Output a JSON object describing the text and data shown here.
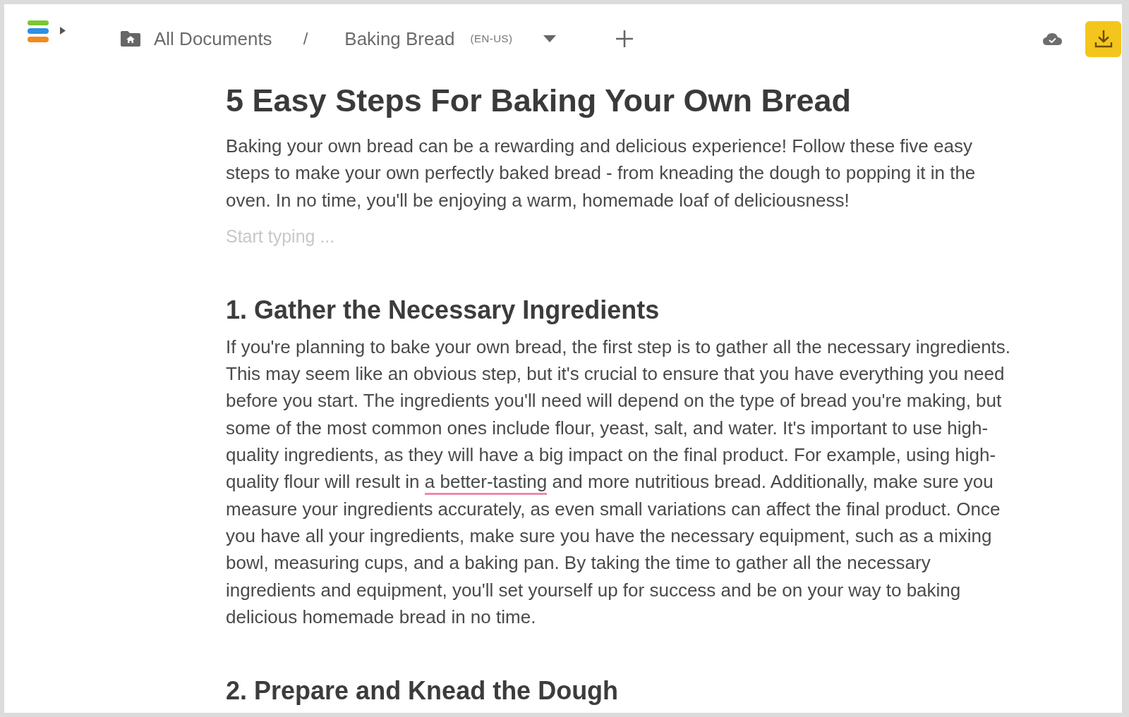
{
  "header": {
    "breadcrumb": {
      "root": "All Documents",
      "separator": "/",
      "current": "Baking Bread",
      "language": "(EN-US)"
    }
  },
  "document": {
    "title": "5 Easy Steps For Baking Your Own Bread",
    "blocks": [
      {
        "kind": "paragraph",
        "segments": [
          {
            "text": "Baking your own bread can be a rewarding and delicious experience! Follow these five easy steps to make your own perfectly baked bread - from kneading the dough to popping it in the oven. In no time, you'll be enjoying a warm, homemade loaf of deliciousness!",
            "flagged": false
          }
        ]
      },
      {
        "kind": "empty",
        "placeholder": "Start typing ..."
      },
      {
        "kind": "heading",
        "text": "1. Gather the Necessary Ingredients"
      },
      {
        "kind": "paragraph",
        "segments": [
          {
            "text": "If you're planning to bake your own bread, the first step is to gather all the necessary ingredients. This may seem like an obvious step, but it's crucial to ensure that you have everything you need before you start. The ingredients you'll need will depend on the type of bread you're making, but some of the most common ones include flour, yeast, salt, and water. It's important to use high-quality ingredients, as they will have a big impact on the final product. For example, using high-quality flour will result in ",
            "flagged": false
          },
          {
            "text": "a better-tasting",
            "flagged": true
          },
          {
            "text": " and more nutritious bread. Additionally, make sure you measure your ingredients accurately, as even small variations can affect the final product. Once you have all your ingredients, make sure you have the necessary equipment, such as a mixing bowl, measuring cups, and a baking pan. By taking the time to gather all the necessary ingredients and equipment, you'll set yourself up for success and be on your way to baking delicious homemade bread in no time.",
            "flagged": false
          }
        ]
      },
      {
        "kind": "heading",
        "text": "2. Prepare and Knead the Dough"
      }
    ]
  }
}
